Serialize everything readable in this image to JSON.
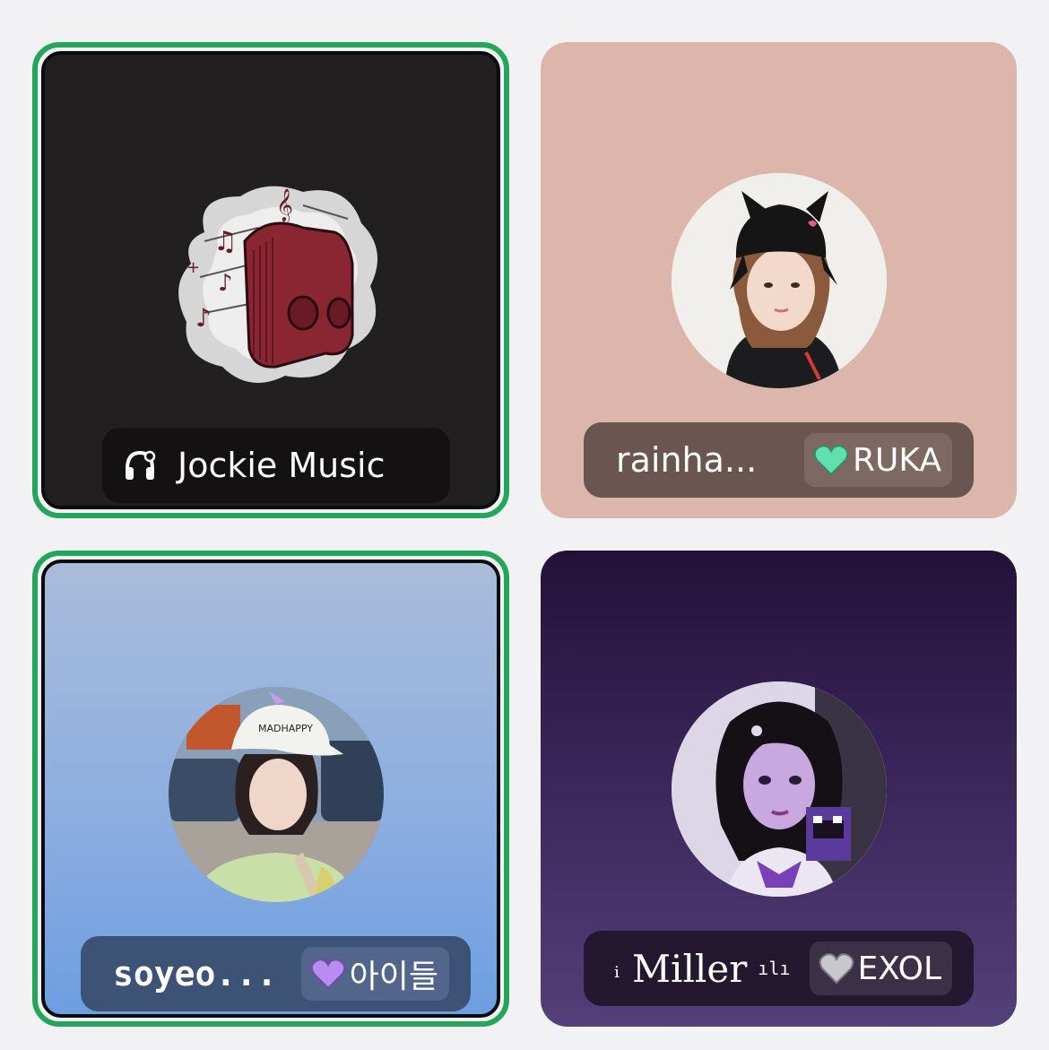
{
  "participants": [
    {
      "id": "jockie",
      "display_name": "Jockie Music",
      "speaking": true,
      "bot_icon": "headphones-icon",
      "avatar_icon": "discord-music-mascot",
      "tile_color": "#221f20",
      "namebar_color": "#131112"
    },
    {
      "id": "rainha",
      "display_name": "rainha...",
      "speaking": false,
      "tag": {
        "label": "RUKA",
        "heart_color": "#5fe0b0"
      },
      "avatar_icon": "user-avatar-photo",
      "tile_color": "#dcb6ab",
      "namebar_color": "#6b5550"
    },
    {
      "id": "soyeo",
      "display_name": "soyeo...",
      "speaking": true,
      "tag": {
        "label": "아이들",
        "heart_color": "#b88cf0"
      },
      "avatar_icon": "user-avatar-photo",
      "tile_color": "#8daee0",
      "namebar_color": "#3c5376"
    },
    {
      "id": "miller",
      "display_name": "Miller",
      "prefix_glyph": "ᵢ",
      "suffix_glyph": "ılı",
      "speaking": false,
      "tag": {
        "label": "EXOL",
        "heart_color": "#c8c8cc"
      },
      "avatar_icon": "user-avatar-photo",
      "tile_color": "#3a2558",
      "namebar_color": "#241830"
    }
  ],
  "colors": {
    "speaking_ring": "#23a55a",
    "page_bg": "#f2f2f4"
  }
}
